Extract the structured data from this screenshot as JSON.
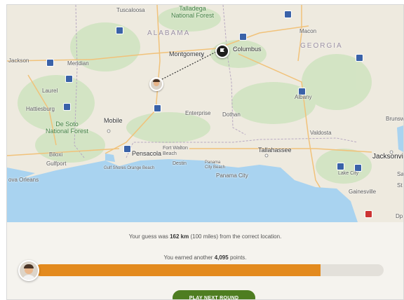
{
  "map": {
    "state_labels": {
      "alabama": "ALABAMA",
      "georgia": "GEORGIA"
    },
    "forest_labels": {
      "talladega": "Talladega\nNational Forest",
      "desoto": "De Soto\nNational Forest"
    },
    "cities": {
      "tuscaloosa": "Tuscaloosa",
      "jackson": "Jackson",
      "meridian": "Meridian",
      "montgomery": "Montgomery",
      "columbus": "Columbus",
      "macon": "Macon",
      "laurel": "Laurel",
      "hattiesburg": "Hattiesburg",
      "albany": "Albany",
      "enterprise": "Enterprise",
      "dothan": "Dothan",
      "brunswick": "Brunsw",
      "mobile": "Mobile",
      "valdosta": "Valdosta",
      "biloxi": "Biloxi",
      "fort_walton": "Fort Walton\nBeach",
      "pensacola": "Pensacola",
      "tallahassee": "Tallahassee",
      "jacksonville": "Jacksonvill",
      "gulfport": "Gulfport",
      "gulf_shores": "Gulf Shores  Orange Beach",
      "destin": "Destin",
      "panama_beach": "Panama\nCity Beach",
      "panama_city": "Panama City",
      "lake_city": "Lake City",
      "new_orleans": "ova Orleans",
      "gainesville": "Gainesville",
      "sa": "Sa",
      "st": "St",
      "dp": "Dp"
    }
  },
  "result": {
    "guess_prefix": "Your guess was ",
    "guess_distance": "162 km",
    "guess_suffix": " (100 miles) from the correct location.",
    "points_prefix": "You earned another ",
    "points_value": "4,095",
    "points_suffix": " points.",
    "progress_fraction": 0.819,
    "next_button": "PLAY NEXT ROUND"
  },
  "colors": {
    "progress": "#e38a1e",
    "button": "#4e7d21",
    "water": "#a9d3f0"
  },
  "icons": {
    "answer_marker": "flag-icon",
    "guess_marker": "player-avatar-icon"
  }
}
